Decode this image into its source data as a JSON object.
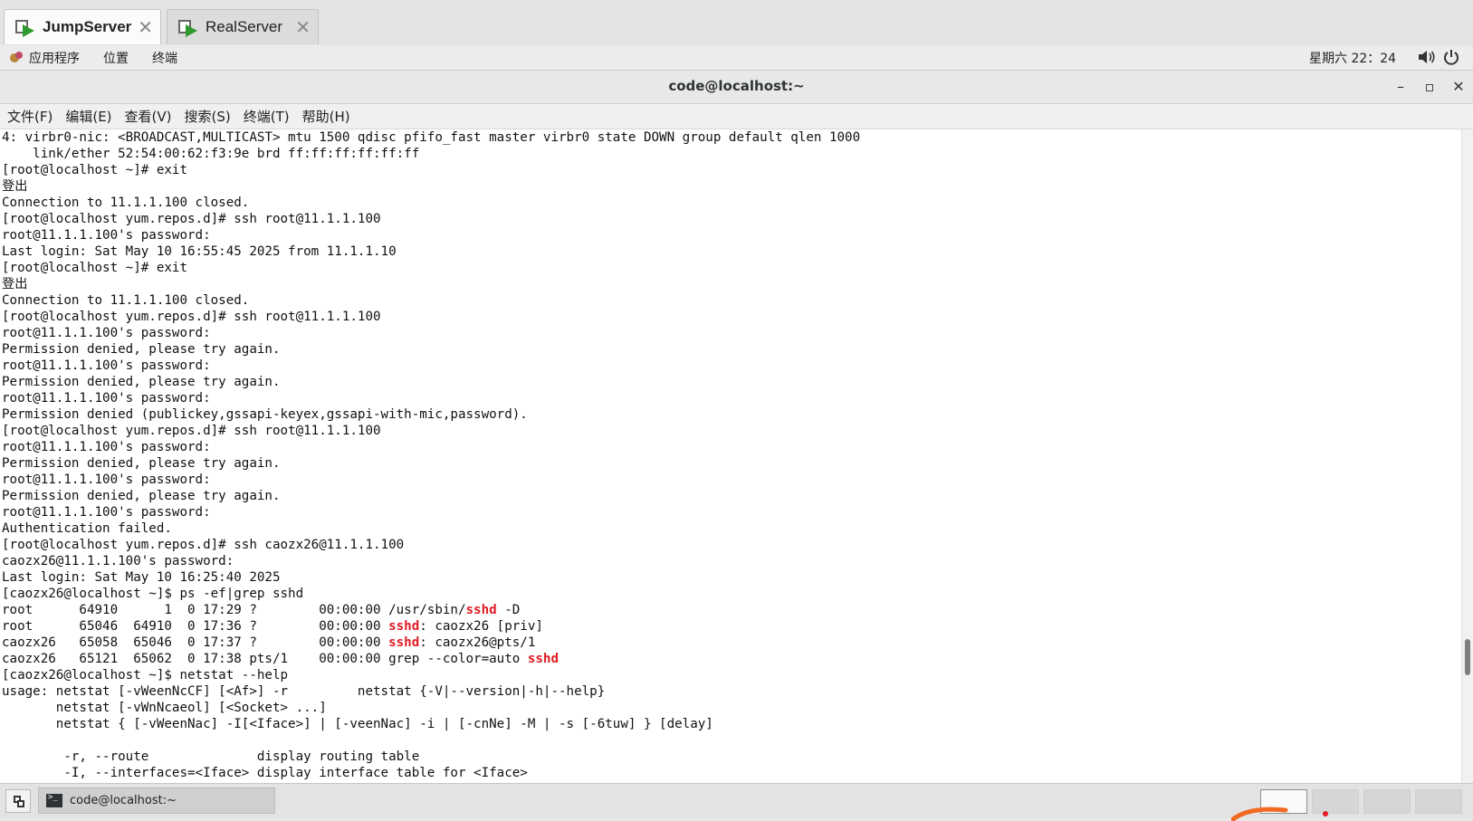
{
  "vm_tabs": [
    {
      "label": "JumpServer"
    },
    {
      "label": "RealServer"
    }
  ],
  "topbar": {
    "apps": "应用程序",
    "places": "位置",
    "terminal": "终端",
    "clock": "星期六 22：24"
  },
  "window": {
    "title": "code@localhost:~"
  },
  "menubar": {
    "file": "文件(F)",
    "edit": "编辑(E)",
    "view": "查看(V)",
    "search": "搜索(S)",
    "terminal": "终端(T)",
    "help": "帮助(H)"
  },
  "terminal": {
    "lines": [
      "4: virbr0-nic: <BROADCAST,MULTICAST> mtu 1500 qdisc pfifo_fast master virbr0 state DOWN group default qlen 1000",
      "    link/ether 52:54:00:62:f3:9e brd ff:ff:ff:ff:ff:ff",
      "[root@localhost ~]# exit",
      "登出",
      "Connection to 11.1.1.100 closed.",
      "[root@localhost yum.repos.d]# ssh root@11.1.1.100",
      "root@11.1.1.100's password:",
      "Last login: Sat May 10 16:55:45 2025 from 11.1.1.10",
      "[root@localhost ~]# exit",
      "登出",
      "Connection to 11.1.1.100 closed.",
      "[root@localhost yum.repos.d]# ssh root@11.1.1.100",
      "root@11.1.1.100's password:",
      "Permission denied, please try again.",
      "root@11.1.1.100's password:",
      "Permission denied, please try again.",
      "root@11.1.1.100's password:",
      "Permission denied (publickey,gssapi-keyex,gssapi-with-mic,password).",
      "[root@localhost yum.repos.d]# ssh root@11.1.1.100",
      "root@11.1.1.100's password:",
      "Permission denied, please try again.",
      "root@11.1.1.100's password:",
      "Permission denied, please try again.",
      "root@11.1.1.100's password:",
      "Authentication failed.",
      "[root@localhost yum.repos.d]# ssh caozx26@11.1.1.100",
      "caozx26@11.1.1.100's password:",
      "Last login: Sat May 10 16:25:40 2025",
      "[caozx26@localhost ~]$ ps -ef|grep sshd",
      "root      64910      1  0 17:29 ?        00:00:00 /usr/sbin/sshd -D",
      "root      65046  64910  0 17:36 ?        00:00:00 sshd: caozx26 [priv]",
      "caozx26   65058  65046  0 17:37 ?        00:00:00 sshd: caozx26@pts/1",
      "caozx26   65121  65062  0 17:38 pts/1    00:00:00 grep --color=auto sshd",
      "[caozx26@localhost ~]$ netstat --help",
      "usage: netstat [-vWeenNcCF] [<Af>] -r         netstat {-V|--version|-h|--help}",
      "       netstat [-vWnNcaeol] [<Socket> ...]",
      "       netstat { [-vWeenNac] -I[<Iface>] | [-veenNac] -i | [-cnNe] -M | -s [-6tuw] } [delay]",
      "",
      "        -r, --route              display routing table",
      "        -I, --interfaces=<Iface> display interface table for <Iface>"
    ],
    "highlight_word": "sshd",
    "highlight_color": "#e01b24"
  },
  "taskbar": {
    "window_item": "code@localhost:~"
  }
}
